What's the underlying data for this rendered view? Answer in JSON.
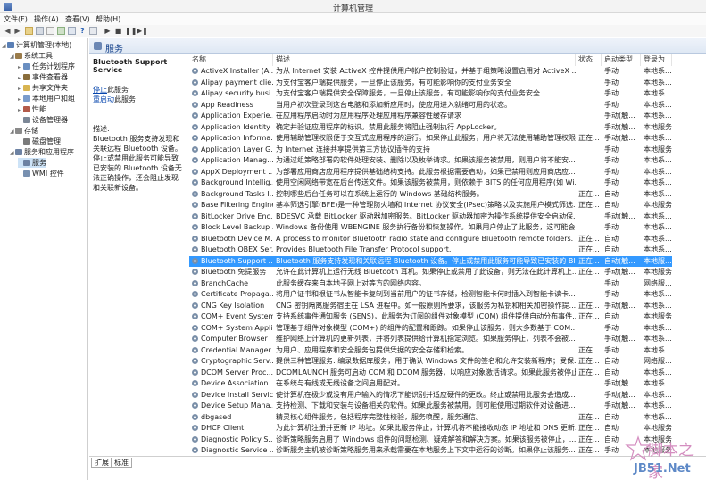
{
  "window": {
    "title": "计算机管理"
  },
  "menu": [
    "文件(F)",
    "操作(A)",
    "查看(V)",
    "帮助(H)"
  ],
  "tree": [
    {
      "label": "计算机管理(本地)",
      "level": 0,
      "icon": "computer-icon",
      "color": "#5a7fb5"
    },
    {
      "label": "系统工具",
      "level": 1,
      "icon": "tools-icon",
      "color": "#9a7b4a"
    },
    {
      "label": "任务计划程序",
      "level": 2,
      "icon": "clock-icon",
      "color": "#6a8fc1"
    },
    {
      "label": "事件查看器",
      "level": 2,
      "icon": "event-viewer-icon",
      "color": "#8a6d3b"
    },
    {
      "label": "共享文件夹",
      "level": 2,
      "icon": "folder-icon",
      "color": "#d8b451"
    },
    {
      "label": "本地用户和组",
      "level": 2,
      "icon": "users-icon",
      "color": "#7a9ccc"
    },
    {
      "label": "性能",
      "level": 2,
      "icon": "performance-icon",
      "color": "#b35b4a"
    },
    {
      "label": "设备管理器",
      "level": 2,
      "icon": "device-manager-icon",
      "color": "#7c8796"
    },
    {
      "label": "存储",
      "level": 1,
      "icon": "storage-icon",
      "color": "#8a8a8a"
    },
    {
      "label": "磁盘管理",
      "level": 2,
      "icon": "disk-icon",
      "color": "#7b7b7b"
    },
    {
      "label": "服务和应用程序",
      "level": 1,
      "icon": "services-apps-icon",
      "color": "#6d82a3"
    },
    {
      "label": "服务",
      "level": 2,
      "icon": "services-icon",
      "color": "#6d82a3",
      "selected": true
    },
    {
      "label": "WMI 控件",
      "level": 2,
      "icon": "wmi-icon",
      "color": "#7890b0"
    }
  ],
  "header": {
    "title": "服务"
  },
  "description": {
    "name": "Bluetooth Support Service",
    "stop_link": "停止",
    "stop_suffix": "此服务",
    "restart_link": "重启动",
    "restart_suffix": "此服务",
    "desc_label": "描述:",
    "desc_text": "Bluetooth 服务支持发现和关联远程 Bluetooth 设备。停止或禁用此服务可能导致已安装的 Bluetooth 设备无法正确操作，还会阻止发现和关联新设备。"
  },
  "columns": {
    "name": "名称",
    "desc": "描述",
    "status": "状态",
    "startup": "启动类型",
    "logon": "登录为"
  },
  "services": [
    {
      "name": "ActiveX Installer (A...",
      "desc": "为从 Internet 安装 ActiveX 控件提供用户帐户控制验证，并基于组策略设置启用对 ActiveX ...",
      "status": "",
      "startup": "手动",
      "logon": "本地系..."
    },
    {
      "name": "Alipay payment clie...",
      "desc": "为支付宝客户端提供服务，一旦停止该服务，有可能影响你的支付业务安全",
      "status": "",
      "startup": "手动",
      "logon": "本地系..."
    },
    {
      "name": "Alipay security busi...",
      "desc": "为支付宝客户端提供安全保障服务，一旦停止该服务，有可能影响你的支付业务安全",
      "status": "",
      "startup": "手动",
      "logon": "本地系..."
    },
    {
      "name": "App Readiness",
      "desc": "当用户初次登录到这台电脑和添加新应用时，使应用进入就绪可用的状态。",
      "status": "",
      "startup": "手动",
      "logon": "本地系..."
    },
    {
      "name": "Application Experie...",
      "desc": "在应用程序启动时为应用程序处理应用程序兼容性缓存请求",
      "status": "",
      "startup": "手动(触...",
      "logon": "本地系..."
    },
    {
      "name": "Application Identity",
      "desc": "确定并验证应用程序的标识。禁用此服务将阻止强制执行 AppLocker。",
      "status": "",
      "startup": "手动(触...",
      "logon": "本地服务"
    },
    {
      "name": "Application Informa...",
      "desc": "使用辅助管理权限便于交互式应用程序的运行。如果停止此服务，用户将无法使用辅助管理权限...",
      "status": "正在...",
      "startup": "手动(触...",
      "logon": "本地系..."
    },
    {
      "name": "Application Layer G...",
      "desc": "为 Internet 连接共享提供第三方协议插件的支持",
      "status": "",
      "startup": "手动",
      "logon": "本地服务"
    },
    {
      "name": "Application Manag...",
      "desc": "为通过组策略部署的软件处理安装、删除以及枚举请求。如果该服务被禁用，则用户将不能安...",
      "status": "",
      "startup": "手动",
      "logon": "本地系..."
    },
    {
      "name": "AppX Deployment ...",
      "desc": "为部署应用商店应用程序提供基础结构支持。此服务根据需要启动，如果已禁用则应用商店应...",
      "status": "",
      "startup": "手动",
      "logon": "本地系..."
    },
    {
      "name": "Background Intellig...",
      "desc": "使用空闲网络带宽在后台传送文件。如果该服务被禁用，则依赖于 BITS 的任何应用程序(如 Wi...",
      "status": "",
      "startup": "手动",
      "logon": "本地系..."
    },
    {
      "name": "Background Tasks I...",
      "desc": "控制哪些后台任务可以在系统上运行的 Windows 基础结构服务。",
      "status": "正在...",
      "startup": "自动",
      "logon": "本地系..."
    },
    {
      "name": "Base Filtering Engine",
      "desc": "基本筛选引擎(BFE)是一种管理防火墙和 Internet 协议安全(IPsec)策略以及实施用户模式筛选...",
      "status": "正在...",
      "startup": "自动",
      "logon": "本地服务"
    },
    {
      "name": "BitLocker Drive Enc...",
      "desc": "BDESVC 承载 BitLocker 驱动器加密服务。BitLocker 驱动器加密为操作系统提供安全启动保...",
      "status": "",
      "startup": "手动(触...",
      "logon": "本地系..."
    },
    {
      "name": "Block Level Backup ...",
      "desc": "Windows 备份使用 WBENGINE 服务执行备份和恢复操作。如果用户停止了此服务，这可能会...",
      "status": "",
      "startup": "手动",
      "logon": "本地系..."
    },
    {
      "name": "Bluetooth Device M...",
      "desc": "A process to monitor Bluetooth radio state and configure Bluetooth remote folders.",
      "status": "正在...",
      "startup": "自动",
      "logon": "本地系..."
    },
    {
      "name": "Bluetooth OBEX Ser...",
      "desc": "Provides Bluetooth File Transfer Protocol support.",
      "status": "正在...",
      "startup": "自动",
      "logon": "本地系..."
    },
    {
      "name": "Bluetooth Support ...",
      "desc": "Bluetooth 服务支持发现和关联远程 Bluetooth 设备。停止或禁用此服务可能导致已安装的 Bl...",
      "status": "正在...",
      "startup": "自动(触...",
      "logon": "本地服...",
      "selected": true
    },
    {
      "name": "Bluetooth 免提服务",
      "desc": "允许在此计算机上运行无线 Bluetooth 耳机。如果停止或禁用了此设备，则无法在此计算机上...",
      "status": "正在...",
      "startup": "手动(触...",
      "logon": "本地服务"
    },
    {
      "name": "BranchCache",
      "desc": "此服务缓存来自本地子网上对等方的网络内容。",
      "status": "",
      "startup": "手动",
      "logon": "网络服..."
    },
    {
      "name": "Certificate Propaga...",
      "desc": "将用户证书和根证书从智能卡复制到当前用户的证书存储，检测智能卡何时插入到智能卡读卡...",
      "status": "",
      "startup": "手动",
      "logon": "本地系..."
    },
    {
      "name": "CNG Key Isolation",
      "desc": "CNG 密钥隔离服务宿主在 LSA 进程中。如一般原则所要求，该服务为私钥和相关加密操作提...",
      "status": "正在...",
      "startup": "手动(触...",
      "logon": "本地系..."
    },
    {
      "name": "COM+ Event System",
      "desc": "支持系统事件通知服务 (SENS)，此服务为订阅的组件对象模型 (COM) 组件提供自动分布事件...",
      "status": "正在...",
      "startup": "自动",
      "logon": "本地服务"
    },
    {
      "name": "COM+ System Appli...",
      "desc": "管理基于组件对象模型 (COM+) 的组件的配置和跟踪。如果停止该服务，则大多数基于 COM...",
      "status": "",
      "startup": "手动",
      "logon": "本地系..."
    },
    {
      "name": "Computer Browser",
      "desc": "维护网络上计算机的更新列表，并将列表提供给计算机指定浏览。如果服务停止，列表不会被...",
      "status": "",
      "startup": "手动(触...",
      "logon": "本地系..."
    },
    {
      "name": "Credential Manager",
      "desc": "为用户、应用程序和安全服务包提供凭据的安全存储和检索。",
      "status": "正在...",
      "startup": "手动",
      "logon": "本地系..."
    },
    {
      "name": "Cryptographic Serv...",
      "desc": "提供三种管理服务: 编录数据库服务，用于确认 Windows 文件的签名和允许安装新程序；受保...",
      "status": "正在...",
      "startup": "自动",
      "logon": "网络服..."
    },
    {
      "name": "DCOM Server Proc...",
      "desc": "DCOMLAUNCH 服务可启动 COM 和 DCOM 服务器，以响应对象激活请求。如果此服务被停止...",
      "status": "正在...",
      "startup": "自动",
      "logon": "本地系..."
    },
    {
      "name": "Device Association ...",
      "desc": "在系统与有线或无线设备之间启用配对。",
      "status": "",
      "startup": "手动(触...",
      "logon": "本地系..."
    },
    {
      "name": "Device Install Service",
      "desc": "使计算机在极少或没有用户输入的情况下能识别并适应硬件的更改。终止或禁用此服务会造成...",
      "status": "",
      "startup": "手动(触...",
      "logon": "本地系..."
    },
    {
      "name": "Device Setup Mana...",
      "desc": "支持检测、下载和安装与设备相关的软件。如果此服务被禁用，则可能使用过期软件对设备进...",
      "status": "",
      "startup": "手动(触...",
      "logon": "本地系..."
    },
    {
      "name": "dbgased",
      "desc": "精灵核心组件服务，包括程序完整性校验，服务唤醒，服务通信。",
      "status": "正在...",
      "startup": "自动",
      "logon": "本地系..."
    },
    {
      "name": "DHCP Client",
      "desc": "为此计算机注册并更新 IP 地址。如果此服务停止，计算机将不能接收动态 IP 地址和 DNS 更新...",
      "status": "正在...",
      "startup": "自动",
      "logon": "本地服务"
    },
    {
      "name": "Diagnostic Policy S...",
      "desc": "诊断策略服务启用了 Windows 组件的问题检测、疑难解答和解决方案。如果该服务被停止，...",
      "status": "正在...",
      "startup": "自动",
      "logon": "本地服务"
    },
    {
      "name": "Diagnostic Service ...",
      "desc": "诊断服务主机被诊断策略服务用来承载需要在本地服务上下文中运行的诊断。如果停止该服务...",
      "status": "正在...",
      "startup": "手动",
      "logon": "本地服务"
    }
  ],
  "bottom_tabs": [
    "扩展",
    "标准"
  ],
  "watermark": {
    "text": "脚本之家",
    "url": "JB51.Net"
  }
}
